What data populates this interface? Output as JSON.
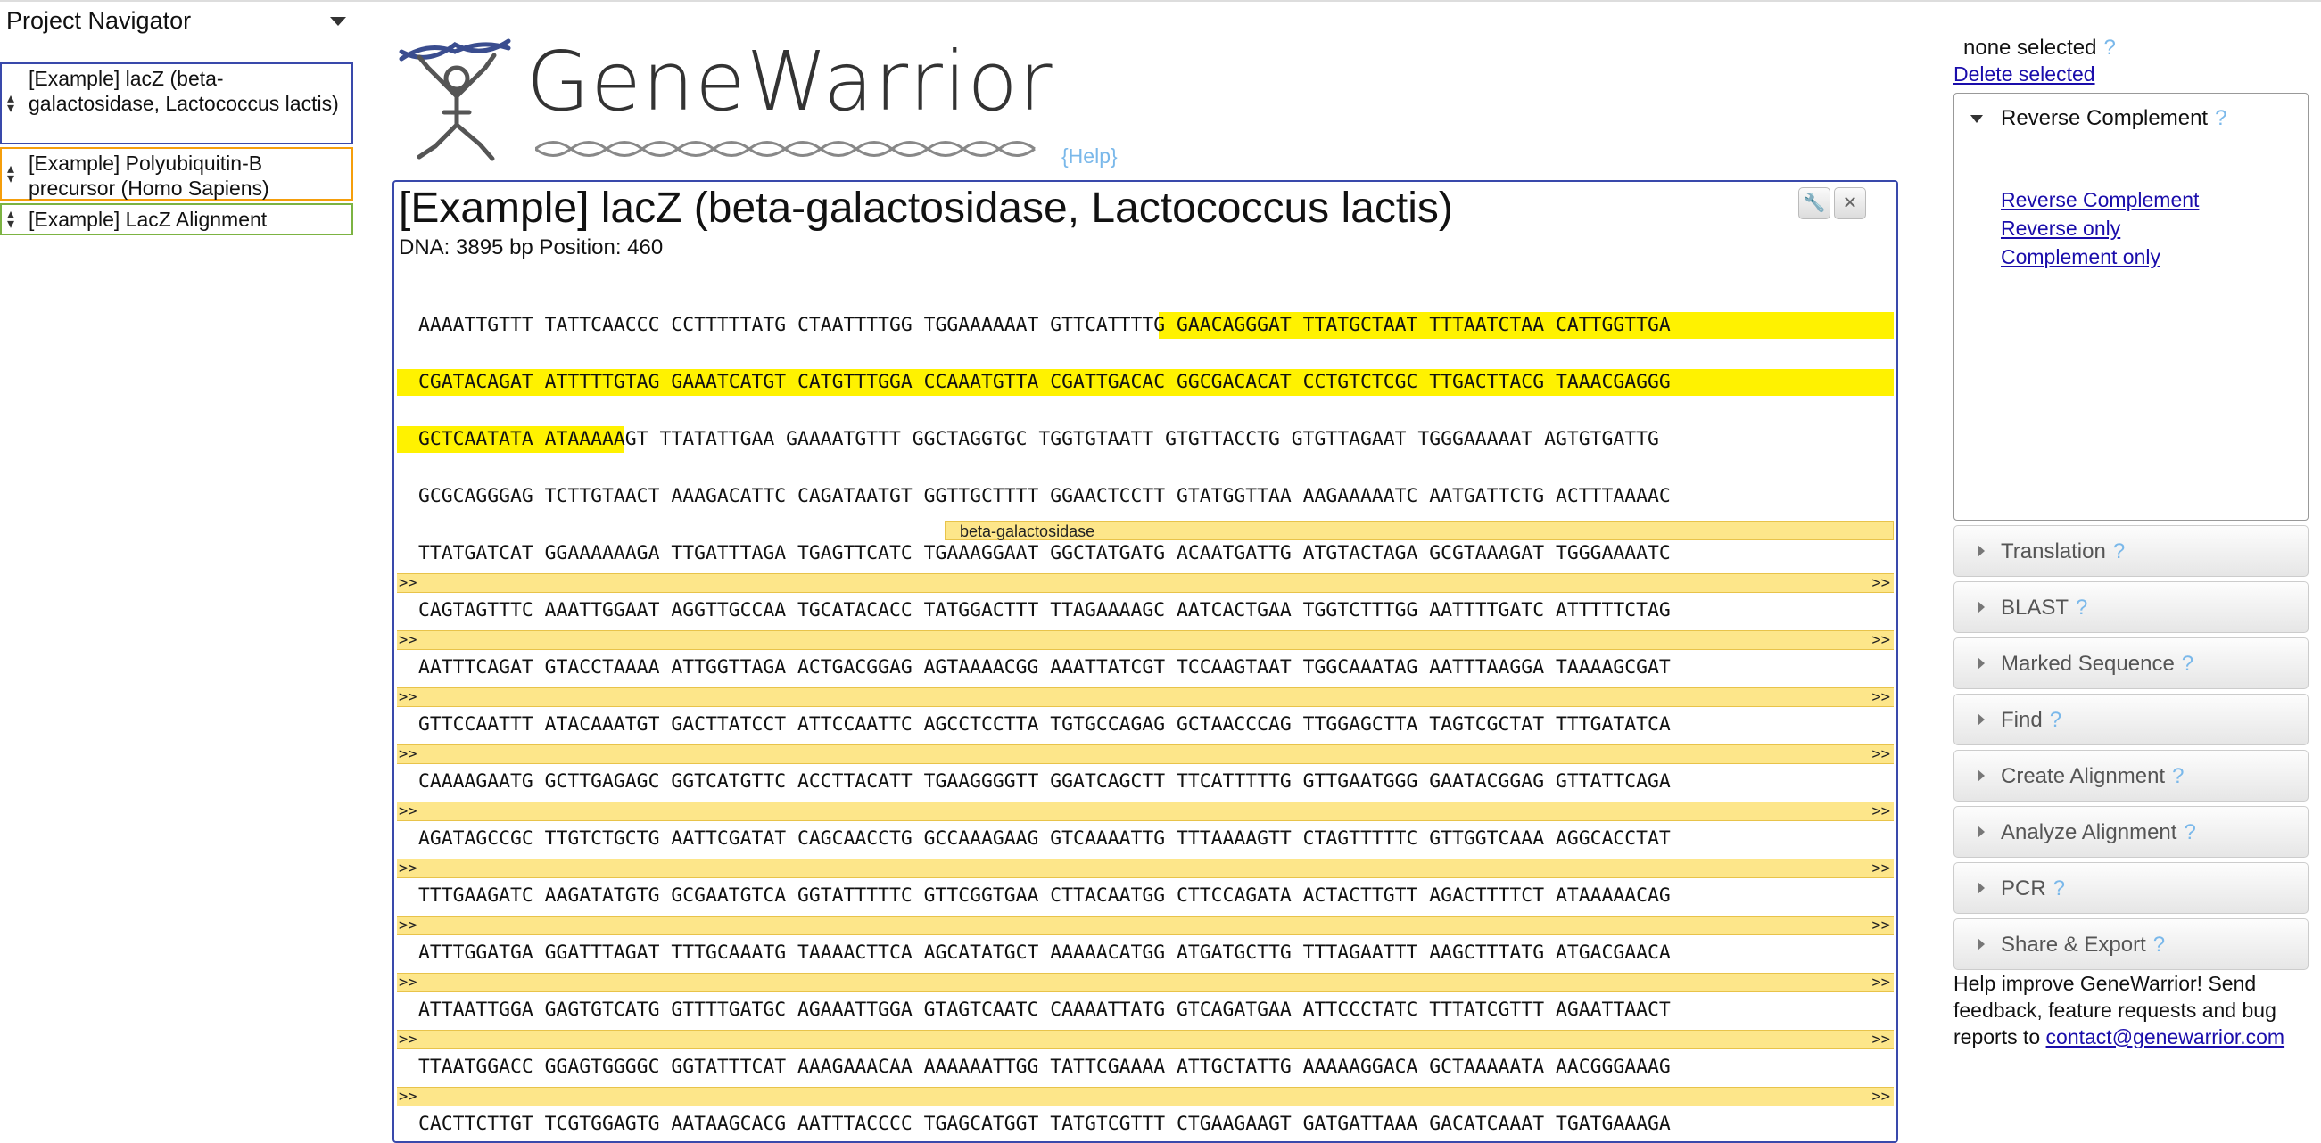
{
  "navigator": {
    "title": "Project Navigator",
    "projects": [
      {
        "label": "[Example] lacZ (beta-galactosidase, Lactococcus lactis)",
        "border_color": "#3949ab"
      },
      {
        "label": "[Example] Polyubiquitin-B precursor (Homo Sapiens)",
        "border_color": "#f59e0b"
      },
      {
        "label": "[Example] LacZ Alignment",
        "border_color": "#7cb342"
      }
    ]
  },
  "header": {
    "logo_text": "GeneWarrior",
    "help_link": "{Help}"
  },
  "sequence": {
    "title": "[Example] lacZ (beta-galactosidase, Lactococcus lactis)",
    "info": "DNA: 3895 bp Position: 460",
    "feature_label": "beta-galactosidase",
    "arrow_left": ">>",
    "arrow_right": ">>",
    "highlight_color": "#fff200",
    "feature_color": "#fde68a",
    "rows": [
      "AAAATTGTTT TATTCAACCC CCTTTTTATG CTAATTTTGG TGGAAAAAAT GTTCATTTTG GAACAGGGAT TTATGCTAAT TTTAATCTAA CATTGGTTGA",
      "CGATACAGAT ATTTTTGTAG GAAATCATGT CATGTTTGGA CCAAATGTTA CGATTGACAC GGCGACACAT CCTGTCTCGC TTGACTTACG TAAACGAGGG",
      "GCTCAATATA ATAAAAAGT TTATATTGAA GAAAATGTTT GGCTAGGTGC TGGTGTAATT GTGTTACCTG GTGTTAGAAT TGGGAAAAAT AGTGTGATTG",
      "GCGCAGGGAG TCTTGTAACT AAAGACATTC CAGATAATGT GGTTGCTTTT GGAACTCCTT GTATGGTTAA AAGAAAAATC AATGATTCTG ACTTTAAAAC",
      "TTATGATCAT GGAAAAAAGA TTGATTTAGA TGAGTTCATC TGAAAGGAAT GGCTATGATG ACAATGATTG ATGTACTAGA GCGTAAAGAT TGGGAAAATC",
      "CAGTAGTTTC AAATTGGAAT AGGTTGCCAA TGCATACACC TATGGACTTT TTAGAAAAGC AATCACTGAA TGGTCTTTGG AATTTTGATC ATTTTTCTAG",
      "AATTTCAGAT GTACCTAAAA ATTGGTTAGA ACTGACGGAG AGTAAAACGG AAATTATCGT TCCAAGTAAT TGGCAAATAG AATTTAAGGA TAAAAGCGAT",
      "GTTCCAATTT ATACAAATGT GACTTATCCT ATTCCAATTC AGCCTCCTTA TGTGCCAGAG GCTAACCCAG TTGGAGCTTA TAGTCGCTAT TTTGATATCA",
      "CAAAAGAATG GCTTGAGAGC GGTCATGTTC ACCTTACATT TGAAGGGGTT GGATCAGCTT TTCATTTTTG GTTGAATGGG GAATACGGAG GTTATTCAGA",
      "AGATAGCCGC TTGTCTGCTG AATTCGATAT CAGCAACCTG GCCAAAGAAG GTCAAAATTG TTTAAAAGTT CTAGTTTTTC GTTGGTCAAA AGGCACCTAT",
      "TTTGAAGATC AAGATATGTG GCGAATGTCA GGTATTTTTC GTTCGGTGAA CTTACAATGG CTTCCAGATA ACTACTTGTT AGACTTTTCT ATAAAAACAG",
      "ATTTGGATGA GGATTTAGAT TTTGCAAATG TAAAACTTCA AGCATATGCT AAAAACATGG ATGATGCTTG TTTAGAATTT AAGCTTTATG ATGACGAACA",
      "ATTAATTGGA GAGTGTCATG GTTTTGATGC AGAAATTGGA GTAGTCAATC CAAAATTATG GTCAGATGAA ATTCCCTATC TTTATCGTTT AGAATTAACT",
      "TTAATGGACC GGAGTGGGGC GGTATTTCAT AAAGAAACAA AAAAAATTGG TATTCGAAAA ATTGCTATTG AAAAAGGACA GCTAAAAATA AACGGGAAAG",
      "CACTTCTTGT TCGTGGAGTG AATAAGCACG AATTTACCCC TGAGCATGGT TATGTCGTTT CTGAAGAAGT GATGATTAAA GACATCAAAT TGATGAAAGA"
    ]
  },
  "tools": {
    "selection_status": "none selected",
    "help_q": "?",
    "delete_selected": "Delete selected",
    "reverse_complement_panel": {
      "title": "Reverse Complement",
      "links": [
        "Reverse Complement",
        "Reverse only",
        "Complement only"
      ]
    },
    "sections": [
      "Translation",
      "BLAST",
      "Marked Sequence",
      "Find",
      "Create Alignment",
      "Analyze Alignment",
      "PCR",
      "Share & Export"
    ],
    "feedback_text": "Help improve GeneWarrior! Send feedback, feature requests and bug reports to",
    "feedback_email": "contact@genewarrior.com"
  }
}
